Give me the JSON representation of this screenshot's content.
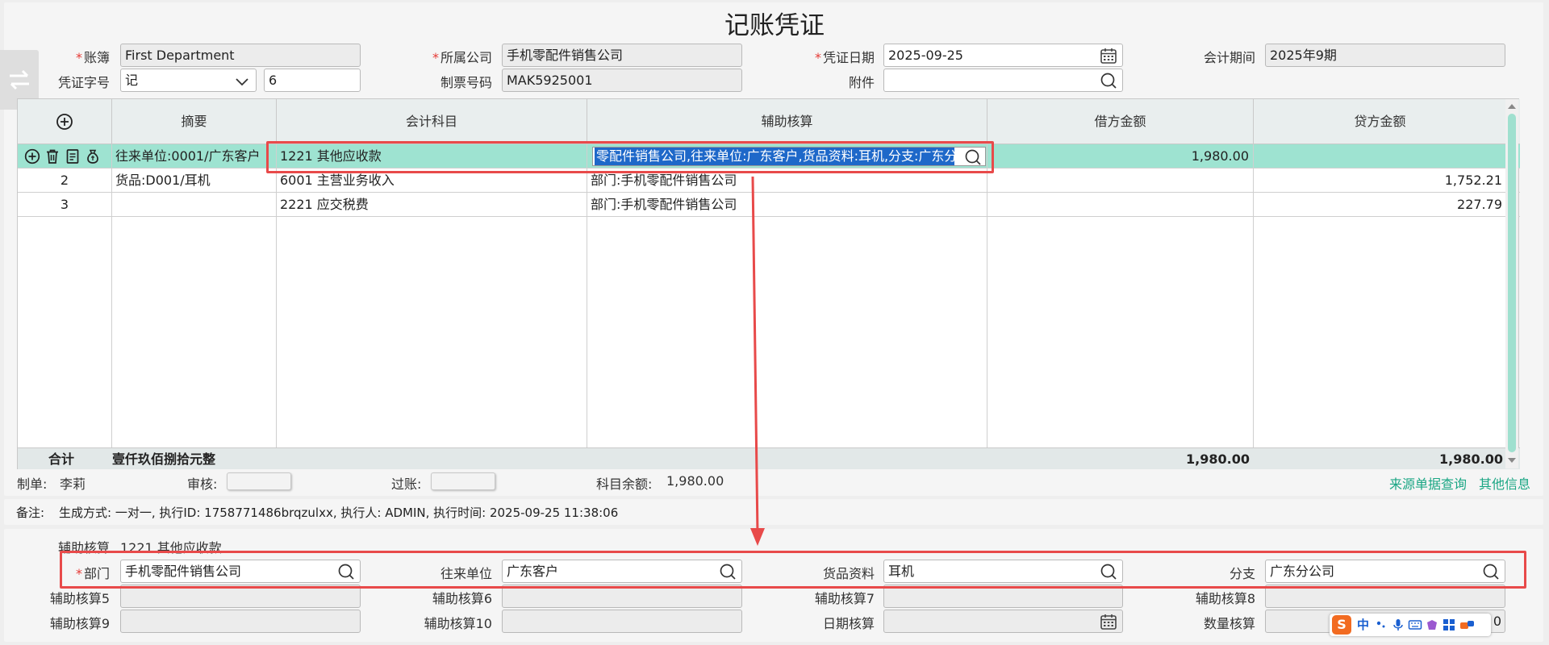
{
  "title": "记账凭证",
  "header": {
    "book_label": "账簿",
    "book_value": "First Department",
    "company_label": "所属公司",
    "company_value": "手机零配件销售公司",
    "date_label": "凭证日期",
    "date_value": "2025-09-25",
    "period_label": "会计期间",
    "period_value": "2025年9期",
    "voucher_word_label": "凭证字号",
    "voucher_word_value": "记",
    "voucher_number_value": "6",
    "invoice_label": "制票号码",
    "invoice_value": "MAK5925001",
    "attachment_label": "附件",
    "attachment_value": ""
  },
  "grid": {
    "columns": [
      "摘要",
      "会计科目",
      "辅助核算",
      "借方金额",
      "贷方金额"
    ],
    "rows": [
      {
        "no": "",
        "summary": "往来单位:0001/广东客户",
        "account": "1221 其他应收款",
        "aux": "零配件销售公司,往来单位:广东客户,货品资料:耳机,分支:广东分",
        "debit": "1,980.00",
        "credit": ""
      },
      {
        "no": "2",
        "summary": "货品:D001/耳机",
        "account": "6001 主营业务收入",
        "aux": "部门:手机零配件销售公司",
        "debit": "",
        "credit": "1,752.21"
      },
      {
        "no": "3",
        "summary": "",
        "account": "2221 应交税费",
        "aux": "部门:手机零配件销售公司",
        "debit": "",
        "credit": "227.79"
      }
    ],
    "total_label": "合计",
    "total_words": "壹仟玖佰捌拾元整",
    "total_debit": "1,980.00",
    "total_credit": "1,980.00"
  },
  "footer": {
    "maker_label": "制单:",
    "maker_value": "李莉",
    "review_label": "审核:",
    "post_label": "过账:",
    "balance_label": "科目余额:",
    "balance_value": "1,980.00",
    "source_link": "来源单据查询",
    "other_link": "其他信息"
  },
  "remark": {
    "label": "备注:",
    "text": "生成方式: 一对一, 执行ID: 1758771486brqzulxx, 执行人: ADMIN, 执行时间: 2025-09-25 11:38:06"
  },
  "aux_panel": {
    "title_label": "辅助核算",
    "title_value": "1221 其他应收款",
    "dept_label": "部门",
    "dept_value": "手机零配件销售公司",
    "partner_label": "往来单位",
    "partner_value": "广东客户",
    "goods_label": "货品资料",
    "goods_value": "耳机",
    "branch_label": "分支",
    "branch_value": "广东分公司",
    "aux5_label": "辅助核算5",
    "aux6_label": "辅助核算6",
    "aux7_label": "辅助核算7",
    "aux8_label": "辅助核算8",
    "aux9_label": "辅助核算9",
    "aux10_label": "辅助核算10",
    "date_aux_label": "日期核算",
    "qty_aux_label": "数量核算",
    "qty_aux_value": "0"
  },
  "ime": {
    "logo": "S",
    "mode": "中"
  },
  "colors": {
    "selected_row": "#9ee3d1",
    "highlight_box": "#e84a4a",
    "link": "#1aa684"
  }
}
